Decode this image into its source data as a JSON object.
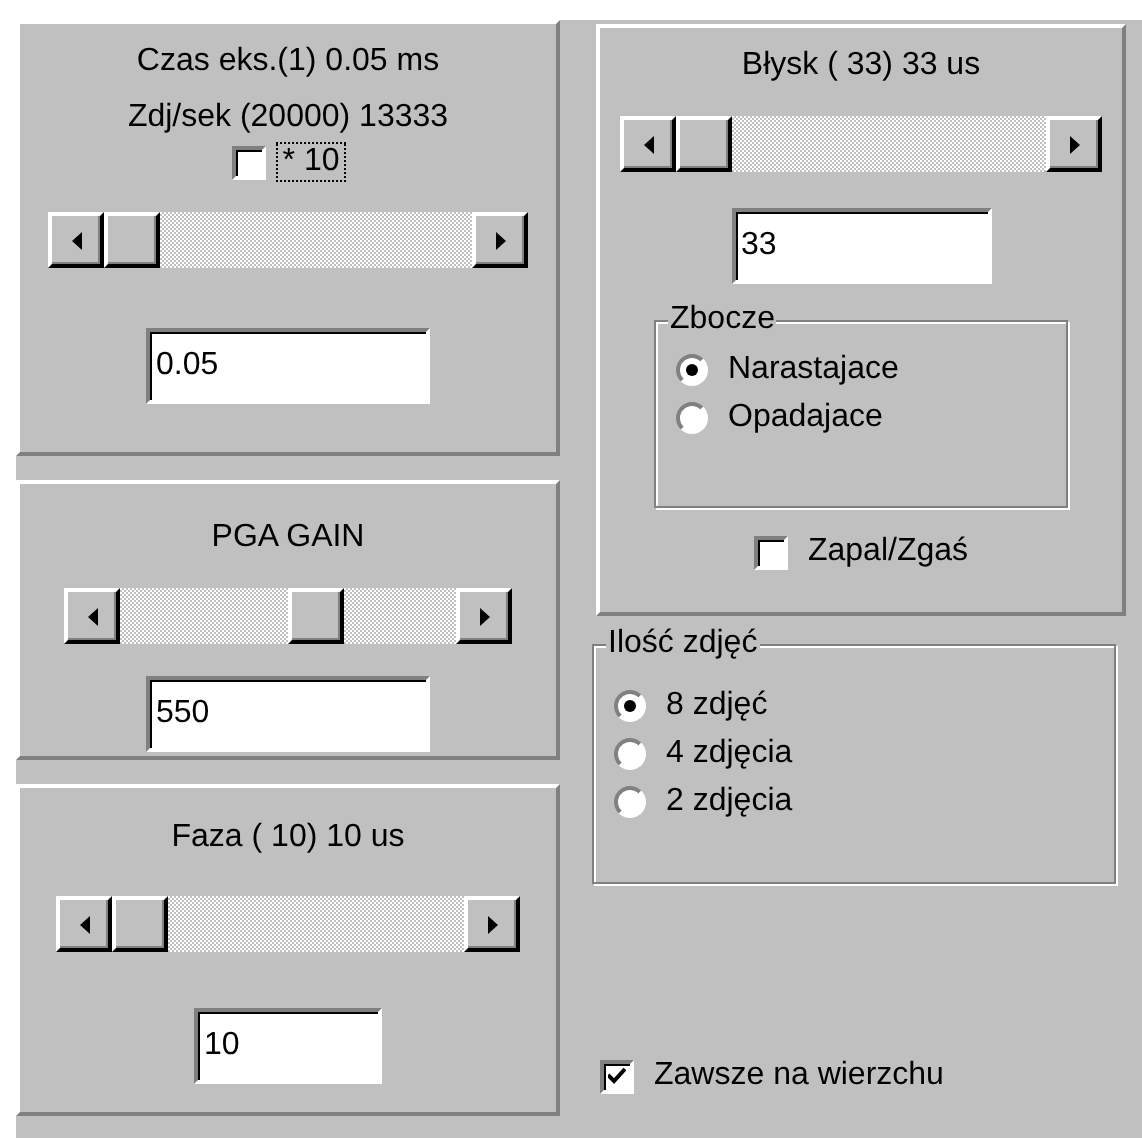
{
  "left_panels": [
    {
      "title": "Czas eks.(1) 0.05 ms",
      "subtitle": "Zdj/sek (20000) 13333",
      "multiplier": {
        "label": "* 10",
        "checked": false
      },
      "value": "0.05"
    },
    {
      "title": "PGA GAIN",
      "value": "550"
    },
    {
      "title": "Faza ( 10) 10 us",
      "value": "10"
    }
  ],
  "flash_panel": {
    "title": "Błysk ( 33) 33 us",
    "value": "33",
    "edge_group": {
      "title": "Zbocze",
      "options": [
        {
          "label": "Narastajace",
          "selected": true
        },
        {
          "label": "Opadajace",
          "selected": false
        }
      ]
    },
    "toggle": {
      "label": "Zapal/Zgaś",
      "checked": false
    }
  },
  "photo_count_group": {
    "title": "Ilość zdjęć",
    "options": [
      {
        "label": "8 zdjęć",
        "selected": true
      },
      {
        "label": "4 zdjęcia",
        "selected": false
      },
      {
        "label": "2 zdjęcia",
        "selected": false
      }
    ]
  },
  "always_on_top": {
    "label": "Zawsze na wierzchu",
    "checked": true
  }
}
